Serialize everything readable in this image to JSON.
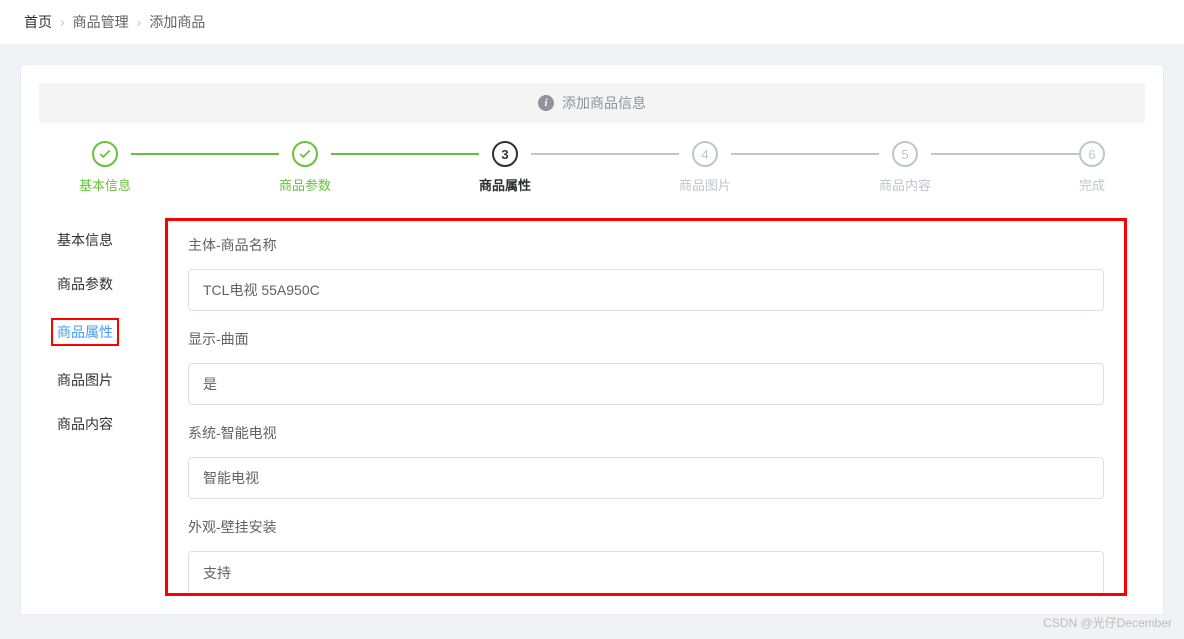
{
  "breadcrumb": {
    "home": "首页",
    "manage": "商品管理",
    "add": "添加商品"
  },
  "alert": {
    "text": "添加商品信息"
  },
  "steps": [
    {
      "label": "基本信息",
      "state": "success"
    },
    {
      "label": "商品参数",
      "state": "success"
    },
    {
      "label": "商品属性",
      "state": "process",
      "num": "3"
    },
    {
      "label": "商品图片",
      "state": "wait",
      "num": "4"
    },
    {
      "label": "商品内容",
      "state": "wait",
      "num": "5"
    },
    {
      "label": "完成",
      "state": "wait",
      "num": "6"
    }
  ],
  "tabs": [
    {
      "label": "基本信息",
      "active": false
    },
    {
      "label": "商品参数",
      "active": false
    },
    {
      "label": "商品属性",
      "active": true
    },
    {
      "label": "商品图片",
      "active": false
    },
    {
      "label": "商品内容",
      "active": false
    }
  ],
  "form": {
    "fields": [
      {
        "label": "主体-商品名称",
        "value": "TCL电视 55A950C"
      },
      {
        "label": "显示-曲面",
        "value": "是"
      },
      {
        "label": "系统-智能电视",
        "value": "智能电视"
      },
      {
        "label": "外观-壁挂安装",
        "value": "支持"
      }
    ]
  },
  "watermark": "CSDN @光仔December"
}
